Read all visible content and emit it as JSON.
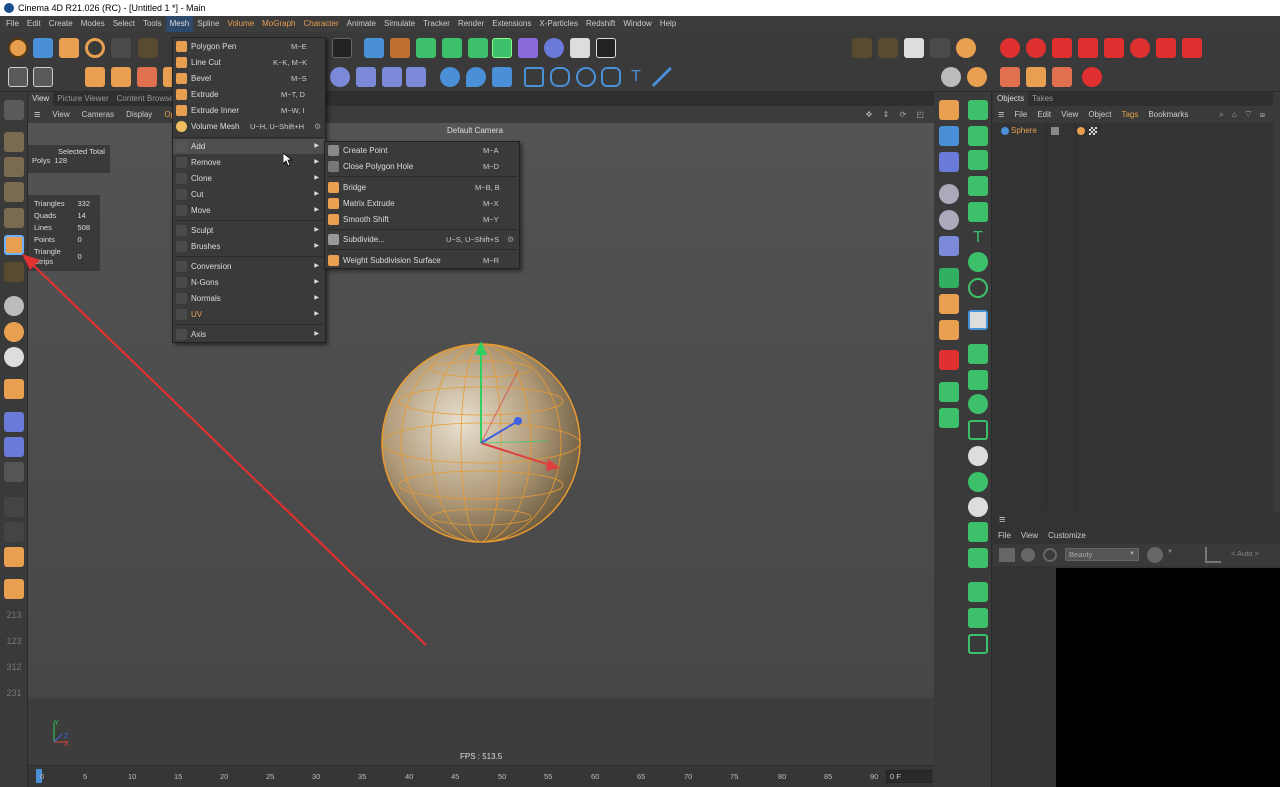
{
  "window": {
    "title": "Cinema 4D R21.026 (RC) - [Untitled 1 *] - Main"
  },
  "menubar": [
    "File",
    "Edit",
    "Create",
    "Modes",
    "Select",
    "Tools",
    "Mesh",
    "Spline",
    "Volume",
    "MoGraph",
    "Character",
    "Animate",
    "Simulate",
    "Tracker",
    "Render",
    "Extensions",
    "X-Particles",
    "Redshift",
    "Window",
    "Help"
  ],
  "viewport": {
    "tabs": [
      "View",
      "Picture Viewer",
      "Content Browser"
    ],
    "menu": [
      "View",
      "Cameras",
      "Display",
      "Optio"
    ],
    "camera_label": "Default Camera",
    "selected_total": {
      "header": "Selected Total",
      "polys_label": "Polys",
      "polys_value": "128"
    },
    "stats": [
      {
        "label": "Triangles",
        "value": "332"
      },
      {
        "label": "Quads",
        "value": "14"
      },
      {
        "label": "Lines",
        "value": "508"
      },
      {
        "label": "Points",
        "value": "0"
      },
      {
        "label": "Triangle Strips",
        "value": "0"
      }
    ],
    "fps": "FPS : 513.5",
    "axis": {
      "y": "Y",
      "z": "Z",
      "x": "X"
    }
  },
  "mesh_menu": {
    "items": [
      {
        "label": "Polygon Pen",
        "shortcut": "M~E"
      },
      {
        "label": "Line Cut",
        "shortcut": "K~K, M~K"
      },
      {
        "label": "Bevel",
        "shortcut": "M~S"
      },
      {
        "label": "Extrude",
        "shortcut": "M~T, D"
      },
      {
        "label": "Extrude Inner",
        "shortcut": "M~W, I"
      },
      {
        "label": "Volume Mesh",
        "shortcut": "U~H, U~Shift+H"
      }
    ],
    "submenus": [
      "Add",
      "Remove",
      "Clone",
      "Cut",
      "Move",
      "Sculpt",
      "Brushes",
      "Conversion",
      "N-Gons",
      "Normals",
      "UV",
      "Axis"
    ]
  },
  "add_submenu": {
    "items": [
      {
        "label": "Create Point",
        "shortcut": "M~A"
      },
      {
        "label": "Close Polygon Hole",
        "shortcut": "M~D"
      },
      {
        "label": "Bridge",
        "shortcut": "M~B, B"
      },
      {
        "label": "Matrix Extrude",
        "shortcut": "M~X"
      },
      {
        "label": "Smooth Shift",
        "shortcut": "M~Y"
      },
      {
        "label": "Subdivide...",
        "shortcut": "U~S, U~Shift+S"
      },
      {
        "label": "Weight Subdivision Surface",
        "shortcut": "M~R"
      }
    ]
  },
  "objects_panel": {
    "tabs": [
      "Objects",
      "Takes"
    ],
    "menu": [
      "File",
      "Edit",
      "View",
      "Object",
      "Tags",
      "Bookmarks"
    ],
    "objects": [
      {
        "name": "Sphere"
      }
    ]
  },
  "render_panel": {
    "menu": [
      "File",
      "View",
      "Customize"
    ],
    "dropdown": "Beauty",
    "auto_label": "< Auto >"
  },
  "timeline": {
    "ticks": [
      "0",
      "5",
      "10",
      "15",
      "20",
      "25",
      "30",
      "35",
      "40",
      "45",
      "50",
      "55",
      "60",
      "65",
      "70",
      "75",
      "80",
      "85",
      "90"
    ],
    "frame_field": "0 F"
  },
  "left_numbers": [
    "213",
    "123",
    "312",
    "231"
  ],
  "colors": {
    "accent": "#e8a050",
    "menu_highlight": "#2e4a6b",
    "red_arrow": "#e03030"
  }
}
